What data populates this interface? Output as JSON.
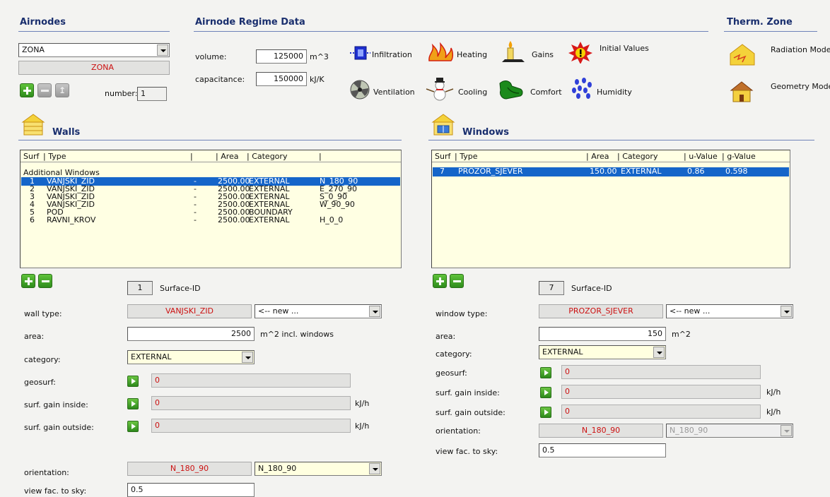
{
  "airnodes": {
    "title": "Airnodes",
    "zone_select": "ZONA",
    "zone_name": "ZONA",
    "number_label": "number:",
    "number_value": "1"
  },
  "regime": {
    "title": "Airnode Regime Data",
    "volume_label": "volume:",
    "volume_value": "125000",
    "volume_unit": "m^3",
    "capacitance_label": "capacitance:",
    "capacitance_value": "150000",
    "capacitance_unit": "kJ/K",
    "buttons": {
      "infiltration": "Infiltration",
      "heating": "Heating",
      "gains": "Gains",
      "initial_values": "Initial Values",
      "ventilation": "Ventilation",
      "cooling": "Cooling",
      "comfort": "Comfort",
      "humidity": "Humidity"
    }
  },
  "therm_zone": {
    "title": "Therm. Zone",
    "radiation_modes": "Radiation Modes",
    "geometry_modes": "Geometry Modes"
  },
  "walls": {
    "title": "Walls",
    "columns": [
      "Surf",
      "| Type",
      "|",
      "| Area",
      "| Category",
      "|"
    ],
    "group_label": "Additional Windows",
    "rows": [
      {
        "surf": "1",
        "type": "VANJSKI_ZID",
        "x": "-",
        "area": "2500.00",
        "category": "EXTERNAL",
        "orient": "N_180_90",
        "selected": true
      },
      {
        "surf": "2",
        "type": "VANJSKI_ZID",
        "x": "-",
        "area": "2500.00",
        "category": "EXTERNAL",
        "orient": "E_270_90"
      },
      {
        "surf": "3",
        "type": "VANJSKI_ZID",
        "x": "-",
        "area": "2500.00",
        "category": "EXTERNAL",
        "orient": "S_0_90"
      },
      {
        "surf": "4",
        "type": "VANJSKI_ZID",
        "x": "-",
        "area": "2500.00",
        "category": "EXTERNAL",
        "orient": "W_90_90"
      },
      {
        "surf": "5",
        "type": "POD",
        "x": "-",
        "area": "2500.00",
        "category": "BOUNDARY",
        "orient": ""
      },
      {
        "surf": "6",
        "type": "RAVNI_KROV",
        "x": "-",
        "area": "2500.00",
        "category": "EXTERNAL",
        "orient": "H_0_0"
      }
    ],
    "surface_id": "1",
    "surface_id_label": "Surface-ID",
    "wall_type_label": "wall type:",
    "wall_type_value": "VANJSKI_ZID",
    "wall_type_combo": "<-- new ...",
    "area_label": "area:",
    "area_value": "2500",
    "area_unit": "m^2   incl. windows",
    "category_label": "category:",
    "category_value": "EXTERNAL",
    "geosurf_label": "geosurf:",
    "geosurf_value": "0",
    "gain_inside_label": "surf. gain inside:",
    "gain_inside_value": "0",
    "gain_inside_unit": "kJ/h",
    "gain_outside_label": "surf. gain outside:",
    "gain_outside_value": "0",
    "gain_outside_unit": "kJ/h",
    "orientation_label": "orientation:",
    "orientation_value": "N_180_90",
    "orientation_combo": "N_180_90",
    "view_fac_label": "view fac. to sky:",
    "view_fac_value": "0.5"
  },
  "windows": {
    "title": "Windows",
    "columns": [
      "Surf",
      "| Type",
      "| Area",
      "| Category",
      "| u-Value",
      "| g-Value"
    ],
    "rows": [
      {
        "surf": "7",
        "type": "PROZOR_SJEVER",
        "area": "150.00",
        "category": "EXTERNAL",
        "u": "0.86",
        "g": "0.598",
        "selected": true
      }
    ],
    "surface_id": "7",
    "surface_id_label": "Surface-ID",
    "window_type_label": "window type:",
    "window_type_value": "PROZOR_SJEVER",
    "window_type_combo": "<-- new ...",
    "area_label": "area:",
    "area_value": "150",
    "area_unit": "m^2",
    "category_label": "category:",
    "category_value": "EXTERNAL",
    "geosurf_label": "geosurf:",
    "geosurf_value": "0",
    "gain_inside_label": "surf. gain inside:",
    "gain_inside_value": "0",
    "gain_inside_unit": "kJ/h",
    "gain_outside_label": "surf. gain outside:",
    "gain_outside_value": "0",
    "gain_outside_unit": "kJ/h",
    "orientation_label": "orientation:",
    "orientation_value": "N_180_90",
    "orientation_combo": "N_180_90",
    "view_fac_label": "view fac. to sky:",
    "view_fac_value": "0.5"
  }
}
